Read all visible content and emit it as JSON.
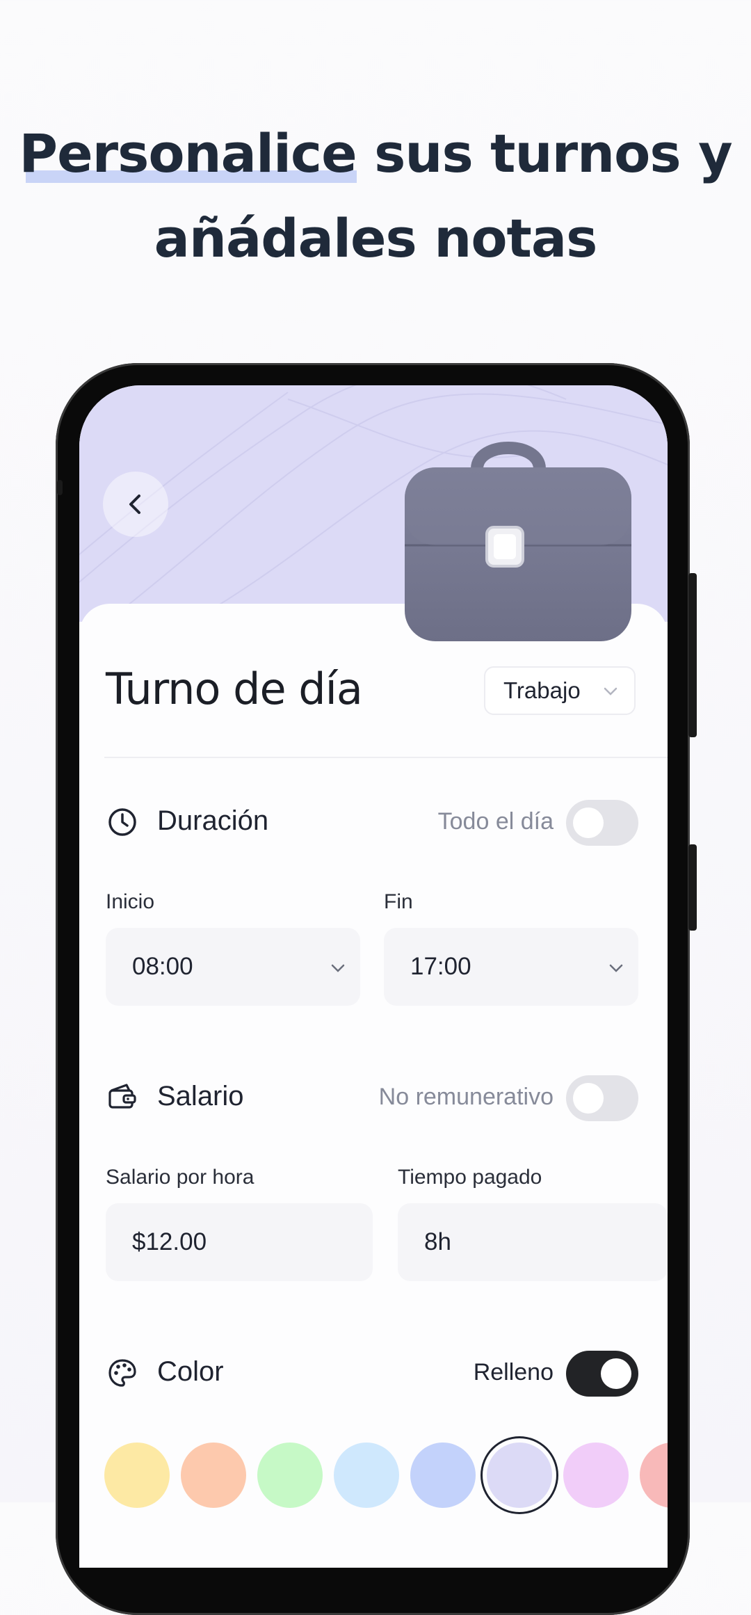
{
  "headline": {
    "line1_highlight": "Personalice",
    "line1_rest": " sus turnos y",
    "line2": "añádales notas"
  },
  "shift": {
    "title": "Turno de día",
    "category_select": "Trabajo"
  },
  "duration": {
    "title": "Duración",
    "all_day_label": "Todo el día",
    "all_day_on": false,
    "start_label": "Inicio",
    "start_value": "08:00",
    "end_label": "Fin",
    "end_value": "17:00"
  },
  "salary": {
    "title": "Salario",
    "unpaid_label": "No remunerativo",
    "unpaid_on": false,
    "hourly_label": "Salario por hora",
    "hourly_value": "$12.00",
    "paid_time_label": "Tiempo pagado",
    "paid_time_value": "8h"
  },
  "color": {
    "title": "Color",
    "fill_label": "Relleno",
    "fill_on": true,
    "swatches": [
      "#fde9a4",
      "#fdc9ad",
      "#c6f9c6",
      "#cfe8fd",
      "#c3d2fb",
      "#dcdaf6",
      "#f1cdf9",
      "#f8b9b9"
    ],
    "selected_index": 5
  },
  "icons": {
    "back": "chevron-left-icon",
    "duration": "clock-icon",
    "salary": "wallet-icon",
    "color": "palette-icon",
    "dropdown": "chevron-down-icon",
    "illustration": "briefcase-icon"
  },
  "colors": {
    "hero_bg": "#dcdaf6",
    "accent_dark": "#222326",
    "highlight": "#c9d4f7"
  }
}
